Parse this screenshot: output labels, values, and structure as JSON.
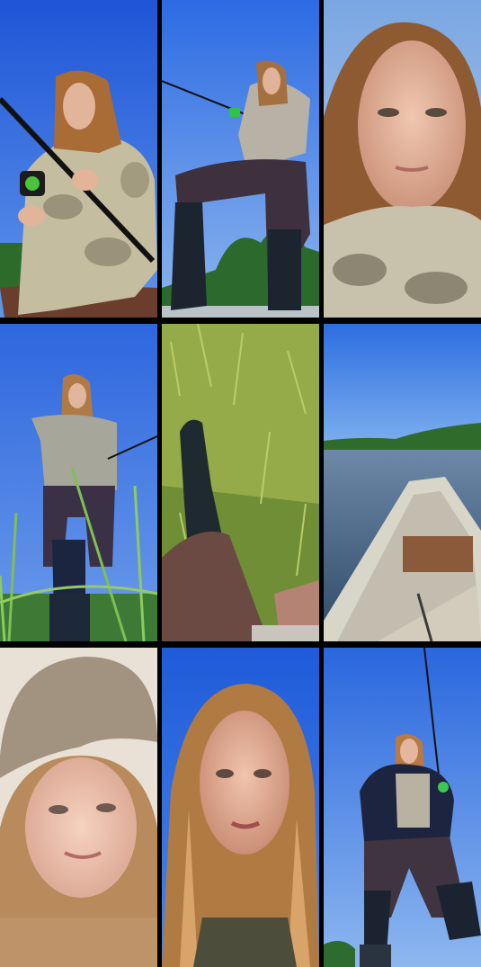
{
  "collage": {
    "layout": "3x3",
    "tiles": [
      {
        "subject": "woman-with-fishing-rod-low-angle"
      },
      {
        "subject": "woman-standing-with-rod-boots"
      },
      {
        "subject": "woman-face-closeup"
      },
      {
        "subject": "woman-holding-rod-tall-grass"
      },
      {
        "subject": "boot-on-grass"
      },
      {
        "subject": "river-from-boat"
      },
      {
        "subject": "woman-in-hat-closeup"
      },
      {
        "subject": "woman-selfie-sunlit-hair"
      },
      {
        "subject": "woman-with-jacket-and-rod"
      }
    ]
  },
  "colors": {
    "sky": "#2f6fe0",
    "sky_light": "#7aa9ea",
    "camo": "#bfb7a0",
    "hair": "#a86b38",
    "skin": "#e6b79c",
    "grass": "#8aa145",
    "water": "#3f5b79",
    "boot": "#202a33",
    "pants": "#3b2f38"
  }
}
